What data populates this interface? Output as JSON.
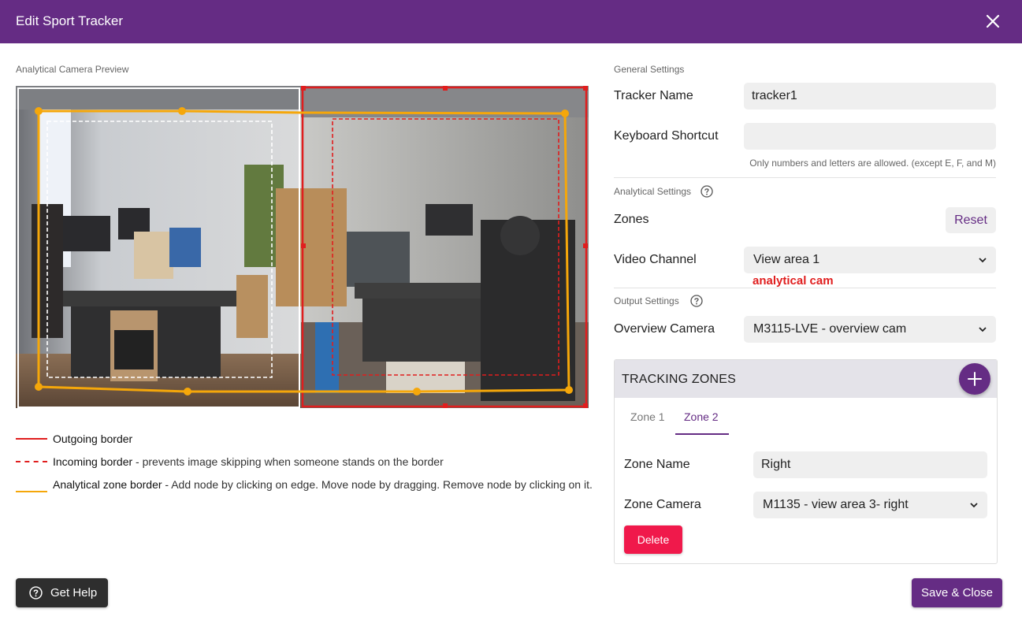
{
  "dialog": {
    "title": "Edit Sport Tracker",
    "close_icon": "close-icon"
  },
  "preview": {
    "label": "Analytical Camera Preview",
    "image": "office camera view split into left and right zones"
  },
  "legend": [
    {
      "name": "Outgoing border",
      "desc": "",
      "color": "#e01e1e",
      "style": "solid"
    },
    {
      "name": "Incoming border",
      "desc": " - prevents image skipping when someone stands on the border",
      "color": "#e01e1e",
      "style": "dashed"
    },
    {
      "name": "Analytical zone border",
      "desc": " - Add node by clicking on edge. Move node by dragging. Remove node by clicking on it.",
      "color": "#f5a70a",
      "style": "solid"
    }
  ],
  "general": {
    "label": "General Settings",
    "tracker_name_label": "Tracker Name",
    "tracker_name_value": "tracker1",
    "shortcut_label": "Keyboard Shortcut",
    "shortcut_value": "",
    "shortcut_hint": "Only numbers and letters are allowed. (except E, F, and M)"
  },
  "analytical": {
    "label": "Analytical Settings",
    "zones_label": "Zones",
    "reset_label": "Reset",
    "video_channel_label": "Video Channel",
    "video_channel_value": "View area 1",
    "note": "analytical cam"
  },
  "output": {
    "label": "Output Settings",
    "overview_label": "Overview Camera",
    "overview_value": "M3115-LVE - overview cam"
  },
  "tracking_zones": {
    "title": "TRACKING ZONES",
    "tabs": [
      "Zone 1",
      "Zone 2"
    ],
    "active_tab": 1,
    "zone_name_label": "Zone Name",
    "zone_name_value": "Right",
    "zone_camera_label": "Zone Camera",
    "zone_camera_value": "M1135 - view area 3- right",
    "delete_label": "Delete"
  },
  "footer": {
    "help_label": "Get Help",
    "save_label": "Save & Close"
  },
  "colors": {
    "accent": "#652c84",
    "danger": "#f0194b",
    "outgoing": "#e01e1e",
    "analytical": "#f5a70a"
  }
}
